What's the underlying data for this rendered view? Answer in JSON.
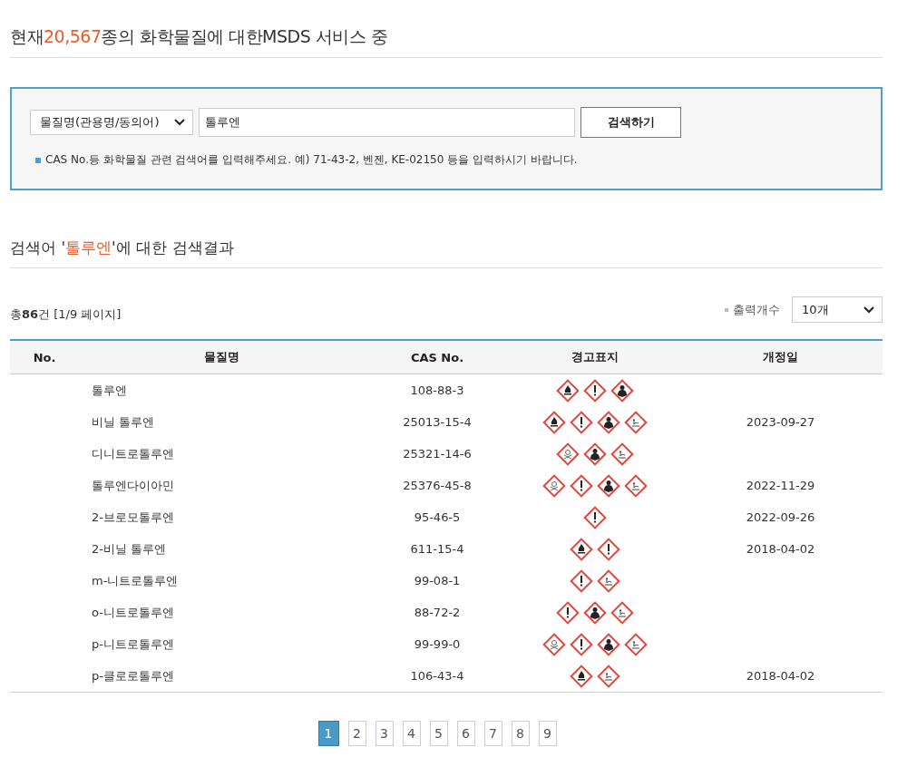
{
  "header": {
    "prefix": "현재",
    "count": "20,567",
    "suffix": "종의 화학물질에 대한MSDS 서비스 중"
  },
  "search": {
    "category": "물질명(관용명/동의어)",
    "value": "톨루엔",
    "button": "검색하기",
    "hint": "CAS No.등 화학물질 관련 검색어를 입력해주세요. 예) 71-43-2, 벤젠, KE-02150 등을 입력하시기 바랍니다."
  },
  "result_heading": {
    "prefix": "검색어 '",
    "term": "톨루엔",
    "suffix": "'에 대한 검색결과"
  },
  "summary": "총**86**건 [1/9 페이지]",
  "page_size": {
    "label": "출력개수",
    "value": "10개"
  },
  "table": {
    "columns": [
      "No.",
      "물질명",
      "CAS No.",
      "경고표지",
      "개정일"
    ],
    "rows": [
      {
        "name": "톨루엔",
        "cas": "108-88-3",
        "pictograms": [
          {
            "kind": "flame"
          },
          {
            "kind": "exclamation"
          },
          {
            "kind": "health"
          }
        ],
        "revised": ""
      },
      {
        "name": "비닐 톨루엔",
        "cas": "25013-15-4",
        "pictograms": [
          {
            "kind": "flame"
          },
          {
            "kind": "exclamation"
          },
          {
            "kind": "health"
          },
          {
            "kind": "environment"
          }
        ],
        "revised": "2023-09-27"
      },
      {
        "name": "디니트로톨루엔",
        "cas": "25321-14-6",
        "pictograms": [
          {
            "kind": "skull"
          },
          {
            "kind": "health"
          },
          {
            "kind": "environment"
          }
        ],
        "revised": ""
      },
      {
        "name": "톨루엔다이아민",
        "cas": "25376-45-8",
        "pictograms": [
          {
            "kind": "skull"
          },
          {
            "kind": "exclamation"
          },
          {
            "kind": "health"
          },
          {
            "kind": "environment"
          }
        ],
        "revised": "2022-11-29"
      },
      {
        "name": "2-브로모톨루엔",
        "cas": "95-46-5",
        "pictograms": [
          {
            "kind": "exclamation"
          }
        ],
        "revised": "2022-09-26"
      },
      {
        "name": "2-비닐 톨루엔",
        "cas": "611-15-4",
        "pictograms": [
          {
            "kind": "flame"
          },
          {
            "kind": "exclamation"
          }
        ],
        "revised": "2018-04-02"
      },
      {
        "name": "m-니트로톨루엔",
        "cas": "99-08-1",
        "pictograms": [
          {
            "kind": "exclamation"
          },
          {
            "kind": "environment"
          }
        ],
        "revised": ""
      },
      {
        "name": "o-니트로톨루엔",
        "cas": "88-72-2",
        "pictograms": [
          {
            "kind": "exclamation"
          },
          {
            "kind": "health"
          },
          {
            "kind": "environment"
          }
        ],
        "revised": ""
      },
      {
        "name": "p-니트로톨루엔",
        "cas": "99-99-0",
        "pictograms": [
          {
            "kind": "skull"
          },
          {
            "kind": "exclamation"
          },
          {
            "kind": "health"
          },
          {
            "kind": "environment"
          }
        ],
        "revised": ""
      },
      {
        "name": "p-클로로톨루엔",
        "cas": "106-43-4",
        "pictograms": [
          {
            "kind": "flame"
          },
          {
            "kind": "environment"
          }
        ],
        "revised": "2018-04-02"
      }
    ]
  },
  "pagination": [
    {
      "label": "1",
      "selected": true
    },
    {
      "label": "2",
      "selected": false
    },
    {
      "label": "3",
      "selected": false
    },
    {
      "label": "4",
      "selected": false
    },
    {
      "label": "5",
      "selected": false
    },
    {
      "label": "6",
      "selected": false
    },
    {
      "label": "7",
      "selected": false
    },
    {
      "label": "8",
      "selected": false
    },
    {
      "label": "9",
      "selected": false
    }
  ]
}
